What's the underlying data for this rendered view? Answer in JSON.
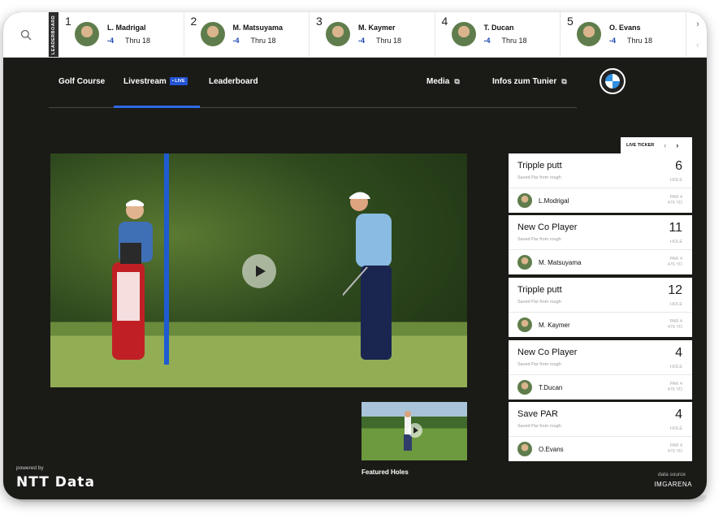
{
  "leaderboard": {
    "tag": "LEADERBOARD",
    "entries": [
      {
        "rank": "1",
        "name": "L. Madrigal",
        "score": "-4",
        "thru": "Thru 18"
      },
      {
        "rank": "2",
        "name": "M. Matsuyama",
        "score": "-4",
        "thru": "Thru 18"
      },
      {
        "rank": "3",
        "name": "M. Kaymer",
        "score": "-4",
        "thru": "Thru 18"
      },
      {
        "rank": "4",
        "name": "T. Ducan",
        "score": "-4",
        "thru": "Thru 18"
      },
      {
        "rank": "5",
        "name": "O. Evans",
        "score": "-4",
        "thru": "Thru 18"
      }
    ]
  },
  "nav": {
    "golf_course": "Golf Course",
    "livestream": "Livestream",
    "live_badge": "• LIVE",
    "leaderboard": "Leaderboard",
    "media": "Media",
    "infos": "Infos zum Tunier"
  },
  "ticker": {
    "label": "LIVE TICKER",
    "cards": [
      {
        "title": "Tripple putt",
        "sub": "Saved Par from rough",
        "hole": "6",
        "hole_label": "HOLE",
        "player": "L.Modrigal",
        "par": "PAR 4",
        "yd": "476 YD"
      },
      {
        "title": "New Co Player",
        "sub": "Saved Par from rough",
        "hole": "11",
        "hole_label": "HOLE",
        "player": "M. Matsuyama",
        "par": "PAR 4",
        "yd": "476 YD"
      },
      {
        "title": "Tripple putt",
        "sub": "Saved Par from rough",
        "hole": "12",
        "hole_label": "HOLE",
        "player": "M. Kaymer",
        "par": "PAR 4",
        "yd": "476 YD"
      },
      {
        "title": "New Co Player",
        "sub": "Saved Par from rough",
        "hole": "4",
        "hole_label": "HOLE",
        "player": "T.Ducan",
        "par": "PAR 4",
        "yd": "476 YD"
      },
      {
        "title": "Save PAR",
        "sub": "Saved Par from rough",
        "hole": "4",
        "hole_label": "HOLE",
        "player": "O.Evans",
        "par": "PAR 4",
        "yd": "476 YD"
      }
    ]
  },
  "featured": {
    "caption": "Featured Holes"
  },
  "footer": {
    "powered_by": "powered by",
    "ntt": "NTT Data",
    "data_source": "data source",
    "imgarena": "IMGARENA"
  },
  "colors": {
    "accent": "#2f6ae6",
    "live": "#2454d4",
    "score": "#1b46b3"
  }
}
